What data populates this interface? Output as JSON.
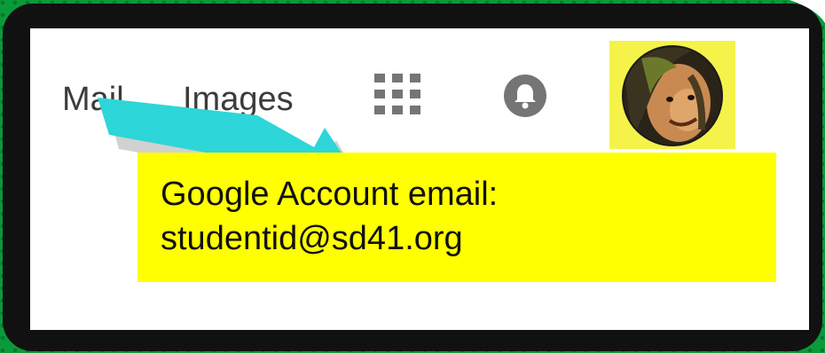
{
  "header": {
    "links": [
      {
        "label": "Mail"
      },
      {
        "label": "Images"
      }
    ],
    "apps_icon": "apps-grid-icon",
    "notifications_icon": "bell-icon",
    "account_avatar": "account-avatar"
  },
  "callout": {
    "line1": "Google Account email:",
    "line2": "studentid@sd41.org"
  },
  "colors": {
    "background": "#0a9a3a",
    "frame": "#111111",
    "arrow": "#2dd6d8",
    "callout": "#ffff00",
    "avatar_highlight": "#f5f24a",
    "icon_gray": "#757575"
  }
}
